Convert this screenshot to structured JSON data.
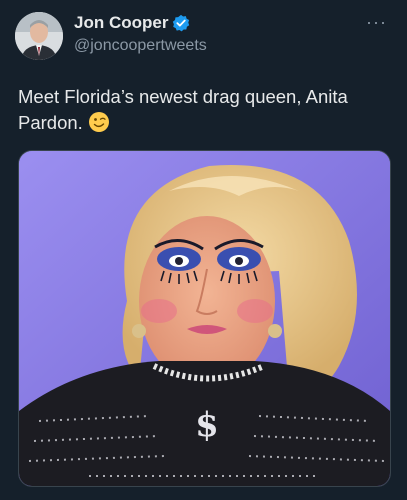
{
  "tweet": {
    "author": {
      "display_name": "Jon Cooper",
      "handle": "@joncoopertweets",
      "verified": true,
      "verified_color": "#1d9bf0"
    },
    "text": "Meet Florida’s newest drag queen, Anita Pardon.",
    "emoji": "winking-face",
    "more_glyph": "···"
  },
  "colors": {
    "background": "#15202b",
    "text": "#e7e9ea",
    "secondary": "#8b98a5",
    "media_bg": "#8a7fe0"
  }
}
